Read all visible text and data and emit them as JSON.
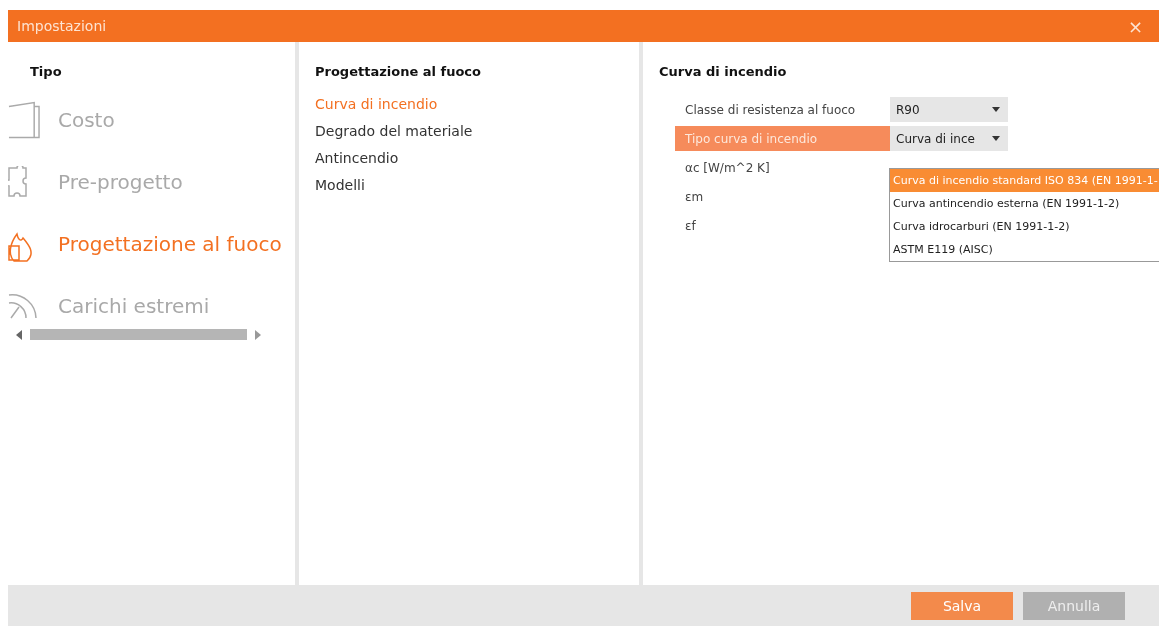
{
  "window": {
    "title": "Impostazioni",
    "close": "×"
  },
  "type_panel": {
    "title": "Tipo",
    "items": [
      {
        "label": "Costo",
        "selected": false
      },
      {
        "label": "Pre-progetto",
        "selected": false
      },
      {
        "label": "Progettazione al fuoco",
        "selected": true
      },
      {
        "label": "Carichi estremi",
        "selected": false
      }
    ]
  },
  "section_panel": {
    "title": "Progettazione al fuoco",
    "items": [
      {
        "label": "Curva di incendio",
        "selected": true
      },
      {
        "label": "Degrado del materiale",
        "selected": false
      },
      {
        "label": "Antincendio",
        "selected": false
      },
      {
        "label": "Modelli",
        "selected": false
      }
    ]
  },
  "settings_panel": {
    "title": "Curva di incendio",
    "rows": [
      {
        "label": "Classe di resistenza al fuoco",
        "kind": "select",
        "value": "R90",
        "selected": false
      },
      {
        "label": "Tipo curva di incendio",
        "kind": "select",
        "value": "Curva di ince",
        "selected": true,
        "options": [
          {
            "label": "Curva di incendio standard ISO 834 (EN 1991-1-",
            "selected": true
          },
          {
            "label": "Curva antincendio esterna (EN 1991-1-2)",
            "selected": false
          },
          {
            "label": "Curva idrocarburi (EN 1991-1-2)",
            "selected": false
          },
          {
            "label": "ASTM E119 (AISC)",
            "selected": false
          }
        ]
      },
      {
        "label": "αc [W/m^2 K]",
        "kind": "text",
        "selected": false
      },
      {
        "label": "εm",
        "kind": "text",
        "selected": false
      },
      {
        "label": "εf",
        "kind": "text",
        "selected": false
      }
    ]
  },
  "buttons": [
    {
      "label": "Salva",
      "kind": "primary"
    },
    {
      "label": "Annulla",
      "kind": "secondary"
    }
  ]
}
